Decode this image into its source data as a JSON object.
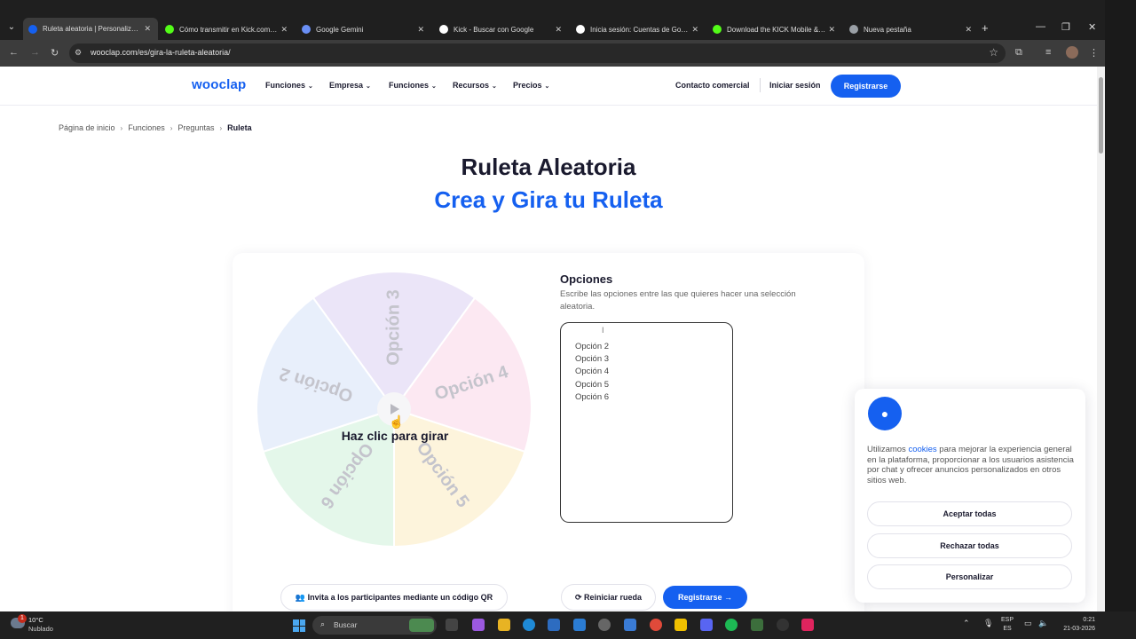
{
  "browser": {
    "tabs": [
      {
        "label": "Ruleta aleatoria | Personaliza y gira",
        "color": "#1560f0",
        "active": true
      },
      {
        "label": "Cómo transmitir en Kick.com | Gu",
        "color": "#53fc18",
        "active": false
      },
      {
        "label": "Google Gemini",
        "color": "#6a8ff5",
        "active": false
      },
      {
        "label": "Kick - Buscar con Google",
        "color": "#ffffff",
        "active": false
      },
      {
        "label": "Inicia sesión: Cuentas de Google",
        "color": "#ffffff",
        "active": false
      },
      {
        "label": "Download the KICK Mobile & TV",
        "color": "#53fc18",
        "active": false
      },
      {
        "label": "Nueva pestaña",
        "color": "#9aa0a6",
        "active": false
      }
    ],
    "close_glyph": "✕",
    "new_tab": "+",
    "url": "wooclap.com/es/gira-la-ruleta-aleatoria/"
  },
  "header": {
    "logo": "wooclap",
    "nav": [
      "Funciones",
      "Empresa",
      "Funciones",
      "Recursos",
      "Precios"
    ],
    "contact": "Contacto comercial",
    "login": "Iniciar sesión",
    "register": "Registrarse"
  },
  "breadcrumb": [
    "Página de inicio",
    "Funciones",
    "Preguntas",
    "Ruleta"
  ],
  "hero": {
    "title": "Ruleta Aleatoria",
    "subtitle": "Crea y Gira tu Ruleta"
  },
  "wheel": {
    "hint": "Haz clic para girar",
    "segments": [
      {
        "label": "Opción 3",
        "color": "#ebe5f8"
      },
      {
        "label": "Opción 4",
        "color": "#fce8f2"
      },
      {
        "label": "Opción 5",
        "color": "#fdf4dc"
      },
      {
        "label": "Opción 6",
        "color": "#e4f7ea"
      },
      {
        "label": "Opción 2",
        "color": "#e8effb"
      }
    ]
  },
  "options": {
    "title": "Opciones",
    "description": "Escribe las opciones entre las que quieres hacer una selección aleatoria.",
    "lines": [
      "Opción 2",
      "Opción 3",
      "Opción 4",
      "Opción 5",
      "Opción 6"
    ]
  },
  "actions": {
    "qr": "Invita a los participantes mediante un código QR",
    "reset": "Reiniciar rueda",
    "register": "Registrarse"
  },
  "cookie": {
    "text_before": "Utilizamos ",
    "link": "cookies",
    "text_after": " para mejorar la experiencia general en la plataforma, proporcionar a los usuarios asistencia por chat y ofrecer anuncios personalizados en otros sitios web.",
    "accept": "Aceptar todas",
    "reject": "Rechazar todas",
    "customize": "Personalizar"
  },
  "taskbar": {
    "weather_temp": "10°C",
    "weather_cond": "Nublado",
    "weather_badge": "1",
    "search": "Buscar",
    "lang_top": "ESP",
    "lang_bottom": "ES",
    "time": "0:21",
    "date": "21-03-2026"
  },
  "colors": {
    "brand": "#1560f0",
    "dark_text": "#1a1a2e"
  }
}
